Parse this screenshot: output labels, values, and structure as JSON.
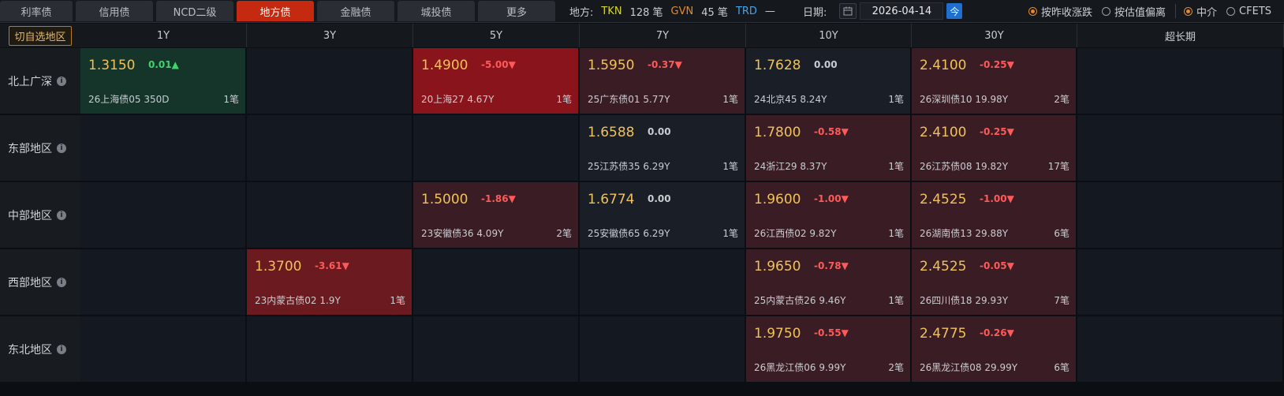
{
  "tabs": [
    {
      "label": "利率债",
      "active": false
    },
    {
      "label": "信用债",
      "active": false
    },
    {
      "label": "NCD二级",
      "active": false
    },
    {
      "label": "地方债",
      "active": true
    },
    {
      "label": "金融债",
      "active": false
    },
    {
      "label": "城投债",
      "active": false
    },
    {
      "label": "更多",
      "active": false
    }
  ],
  "topinfo": {
    "region_label": "地方:",
    "tkn_label": "TKN",
    "tkn_count": "128 笔",
    "gvn_label": "GVN",
    "gvn_count": "45 笔",
    "trd_label": "TRD",
    "trd_count": "—"
  },
  "date": {
    "label": "日期:",
    "value": "2026-04-14",
    "today_button": "今"
  },
  "radios": [
    {
      "label": "按昨收涨跌",
      "on": true
    },
    {
      "label": "按估值偏离",
      "on": false
    },
    {
      "label": "中介",
      "on": true
    },
    {
      "label": "CFETS",
      "on": false
    }
  ],
  "corner_button": "切自选地区",
  "columns": [
    "1Y",
    "3Y",
    "5Y",
    "7Y",
    "10Y",
    "30Y",
    "超长期"
  ],
  "rows": [
    {
      "label": "北上广深",
      "cells": [
        {
          "yield": "1.3150",
          "change": "0.01▲",
          "dir": "pos",
          "name": "26上海债05 350D",
          "count": "1笔",
          "shade": "up"
        },
        null,
        {
          "yield": "1.4900",
          "change": "-5.00▼",
          "dir": "neg",
          "name": "20上海27 4.67Y",
          "count": "1笔",
          "shade": "down3"
        },
        {
          "yield": "1.5950",
          "change": "-0.37▼",
          "dir": "neg",
          "name": "25广东债01 5.77Y",
          "count": "1笔",
          "shade": "down1"
        },
        {
          "yield": "1.7628",
          "change": "0.00",
          "dir": "zero",
          "name": "24北京45 8.24Y",
          "count": "1笔",
          "shade": "neutral"
        },
        {
          "yield": "2.4100",
          "change": "-0.25▼",
          "dir": "neg",
          "name": "26深圳债10 19.98Y",
          "count": "2笔",
          "shade": "down1"
        },
        null
      ]
    },
    {
      "label": "东部地区",
      "cells": [
        null,
        null,
        null,
        {
          "yield": "1.6588",
          "change": "0.00",
          "dir": "zero",
          "name": "25江苏债35 6.29Y",
          "count": "1笔",
          "shade": "neutral"
        },
        {
          "yield": "1.7800",
          "change": "-0.58▼",
          "dir": "neg",
          "name": "24浙江29 8.37Y",
          "count": "1笔",
          "shade": "down1"
        },
        {
          "yield": "2.4100",
          "change": "-0.25▼",
          "dir": "neg",
          "name": "26江苏债08 19.82Y",
          "count": "17笔",
          "shade": "down1"
        },
        null
      ]
    },
    {
      "label": "中部地区",
      "cells": [
        null,
        null,
        {
          "yield": "1.5000",
          "change": "-1.86▼",
          "dir": "neg",
          "name": "23安徽债36 4.09Y",
          "count": "2笔",
          "shade": "down1"
        },
        {
          "yield": "1.6774",
          "change": "0.00",
          "dir": "zero",
          "name": "25安徽债65 6.29Y",
          "count": "1笔",
          "shade": "neutral"
        },
        {
          "yield": "1.9600",
          "change": "-1.00▼",
          "dir": "neg",
          "name": "26江西债02 9.82Y",
          "count": "1笔",
          "shade": "down1"
        },
        {
          "yield": "2.4525",
          "change": "-1.00▼",
          "dir": "neg",
          "name": "26湖南债13 29.88Y",
          "count": "6笔",
          "shade": "down1"
        },
        null
      ]
    },
    {
      "label": "西部地区",
      "cells": [
        null,
        {
          "yield": "1.3700",
          "change": "-3.61▼",
          "dir": "neg",
          "name": "23内蒙古债02 1.9Y",
          "count": "1笔",
          "shade": "down2"
        },
        null,
        null,
        {
          "yield": "1.9650",
          "change": "-0.78▼",
          "dir": "neg",
          "name": "25内蒙古债26 9.46Y",
          "count": "1笔",
          "shade": "down1"
        },
        {
          "yield": "2.4525",
          "change": "-0.05▼",
          "dir": "neg",
          "name": "26四川债18 29.93Y",
          "count": "7笔",
          "shade": "down1"
        },
        null
      ]
    },
    {
      "label": "东北地区",
      "cells": [
        null,
        null,
        null,
        null,
        {
          "yield": "1.9750",
          "change": "-0.55▼",
          "dir": "neg",
          "name": "26黑龙江债06 9.99Y",
          "count": "2笔",
          "shade": "down1"
        },
        {
          "yield": "2.4775",
          "change": "-0.26▼",
          "dir": "neg",
          "name": "26黑龙江债08 29.99Y",
          "count": "6笔",
          "shade": "down1"
        },
        null
      ]
    }
  ]
}
